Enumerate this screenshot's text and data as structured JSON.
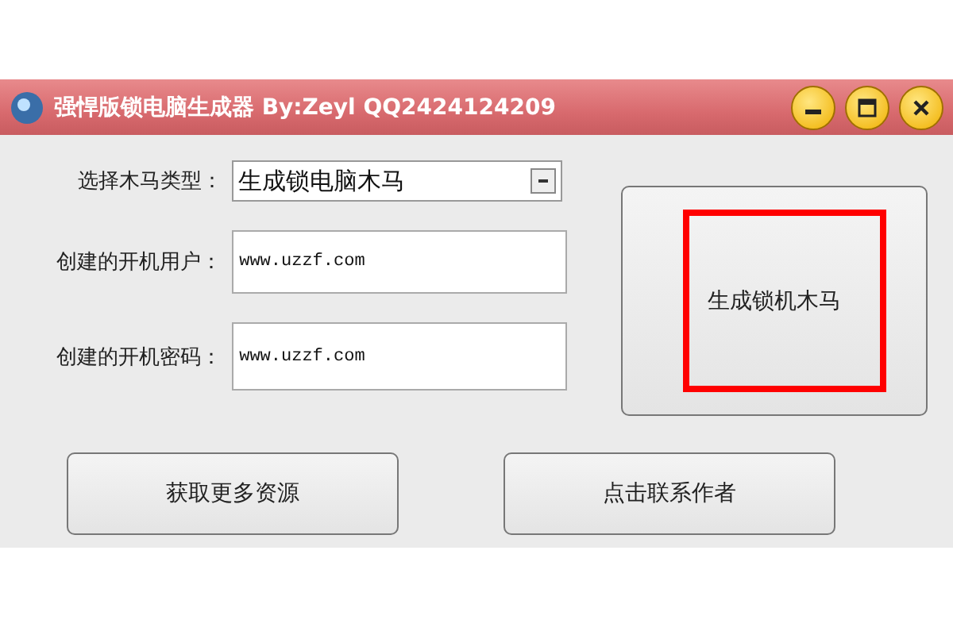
{
  "window": {
    "title": "强悍版锁电脑生成器 By:Zeyl QQ2424124209"
  },
  "form": [
    {
      "kind": "combo",
      "label": "选择木马类型：",
      "value": "生成锁电脑木马"
    },
    {
      "kind": "text",
      "label": "创建的开机用户：",
      "value": "www.uzzf.com"
    },
    {
      "kind": "text",
      "label": "创建的开机密码：",
      "value": "www.uzzf.com"
    }
  ],
  "generate_button": {
    "label": "生成锁机木马",
    "highlighted": true
  },
  "buttons": [
    "获取更多资源",
    "点击联系作者"
  ]
}
